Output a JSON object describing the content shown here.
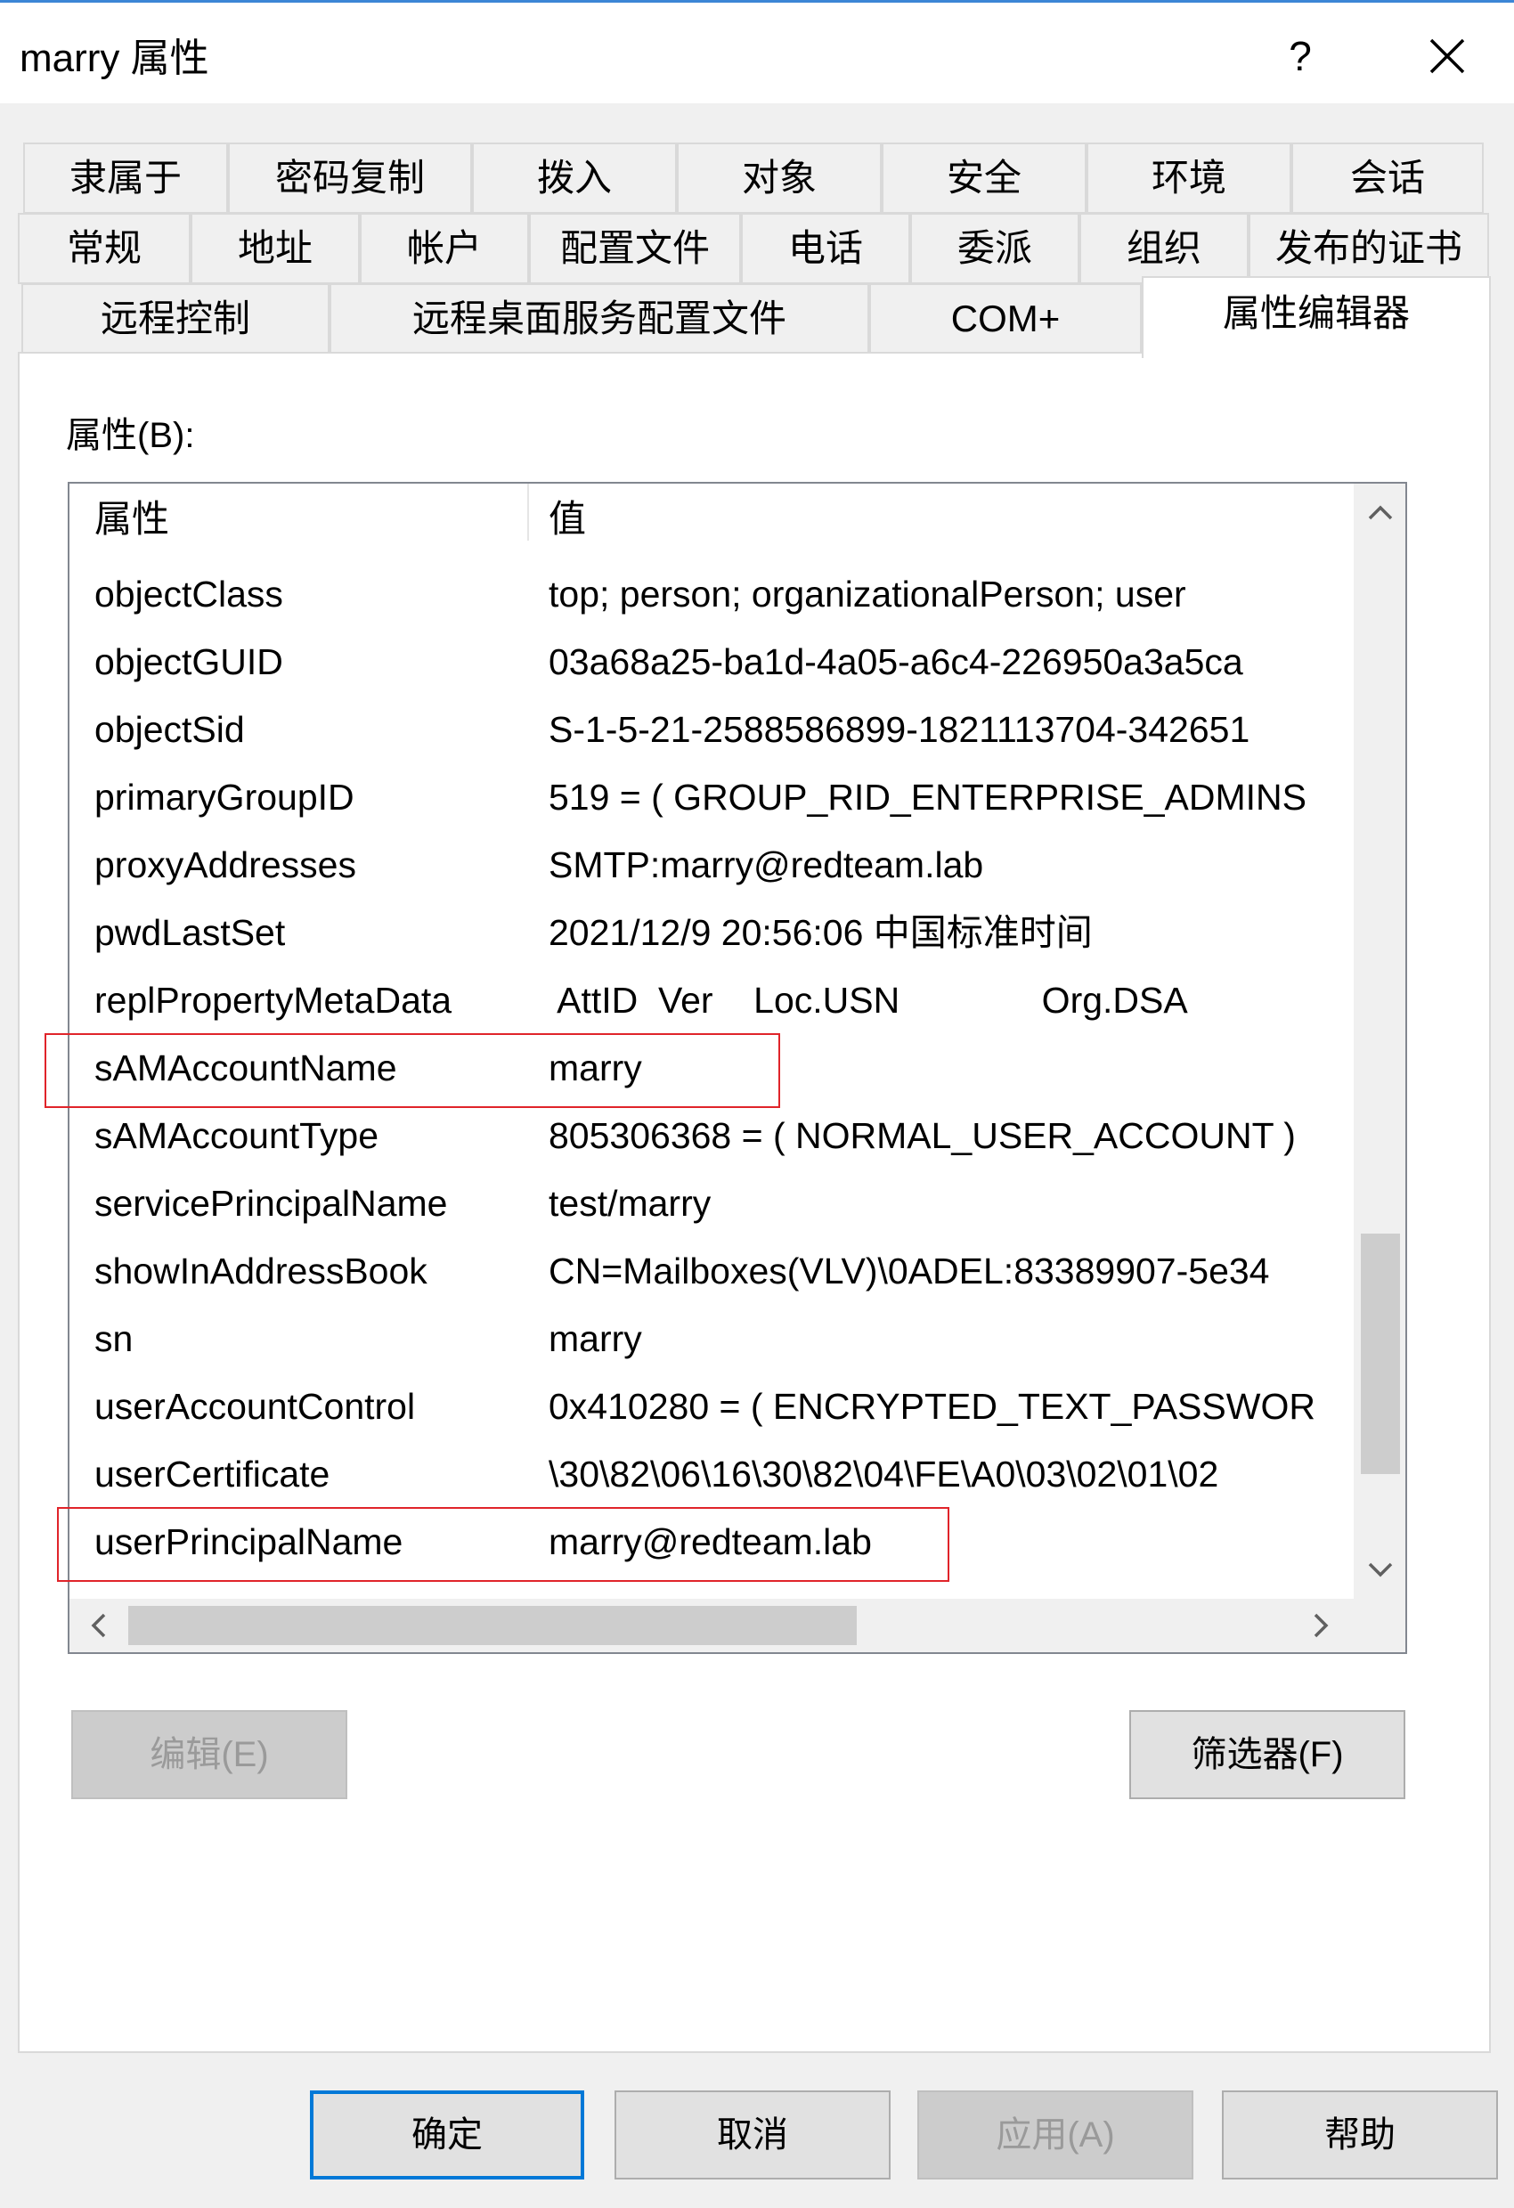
{
  "window": {
    "title": "marry 属性",
    "help_label": "?"
  },
  "tabs": {
    "row1": [
      "隶属于",
      "密码复制",
      "拨入",
      "对象",
      "安全",
      "环境",
      "会话"
    ],
    "row2": [
      "常规",
      "地址",
      "帐户",
      "配置文件",
      "电话",
      "委派",
      "组织",
      "发布的证书"
    ],
    "row3": [
      "远程控制",
      "远程桌面服务配置文件",
      "COM+",
      "属性编辑器"
    ],
    "active": "属性编辑器"
  },
  "attributes_label": "属性(B):",
  "list": {
    "headers": [
      "属性",
      "值"
    ],
    "rows": [
      {
        "attr": "objectClass",
        "value": "top; person; organizationalPerson; user"
      },
      {
        "attr": "objectGUID",
        "value": "03a68a25-ba1d-4a05-a6c4-226950a3a5ca"
      },
      {
        "attr": "objectSid",
        "value": "S-1-5-21-2588586899-1821113704-342651"
      },
      {
        "attr": "primaryGroupID",
        "value": "519 = ( GROUP_RID_ENTERPRISE_ADMINS"
      },
      {
        "attr": "proxyAddresses",
        "value": "SMTP:marry@redteam.lab"
      },
      {
        "attr": "pwdLastSet",
        "value": "2021/12/9 20:56:06 中国标准时间"
      },
      {
        "attr": "replPropertyMetaData",
        "value": " AttID  Ver    Loc.USN              Org.DSA"
      },
      {
        "attr": "sAMAccountName",
        "value": "marry"
      },
      {
        "attr": "sAMAccountType",
        "value": "805306368 = ( NORMAL_USER_ACCOUNT )"
      },
      {
        "attr": "servicePrincipalName",
        "value": "test/marry"
      },
      {
        "attr": "showInAddressBook",
        "value": "CN=Mailboxes(VLV)\\0ADEL:83389907-5e34"
      },
      {
        "attr": "sn",
        "value": "marry"
      },
      {
        "attr": "userAccountControl",
        "value": "0x410280 = ( ENCRYPTED_TEXT_PASSWOR"
      },
      {
        "attr": "userCertificate",
        "value": "\\30\\82\\06\\16\\30\\82\\04\\FE\\A0\\03\\02\\01\\02"
      },
      {
        "attr": "userPrincipalName",
        "value": "marry@redteam.lab"
      }
    ]
  },
  "buttons": {
    "edit": "编辑(E)",
    "filter": "筛选器(F)",
    "ok": "确定",
    "cancel": "取消",
    "apply": "应用(A)",
    "help": "帮助"
  },
  "colors": {
    "highlight_box": "#e0242a",
    "title_accent": "#3c86d6",
    "default_button_border": "#0078d7"
  }
}
